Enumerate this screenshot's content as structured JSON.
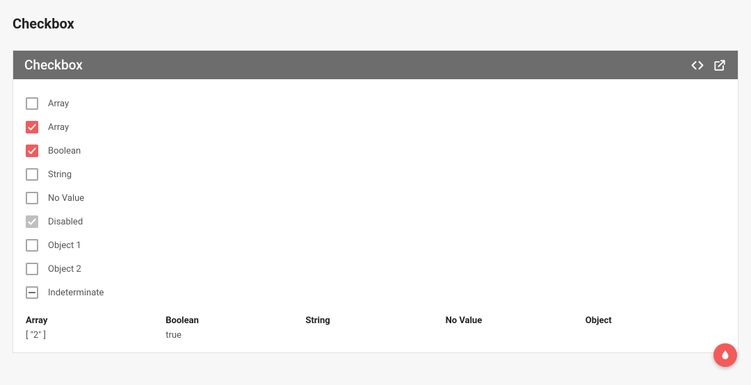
{
  "page": {
    "title": "Checkbox"
  },
  "card": {
    "title": "Checkbox"
  },
  "colors": {
    "accent": "#f45a5a",
    "header_bg": "#6d6d6d",
    "disabled_fill": "#bfbfbf"
  },
  "checkboxes": [
    {
      "label": "Array",
      "state": "unchecked"
    },
    {
      "label": "Array",
      "state": "checked"
    },
    {
      "label": "Boolean",
      "state": "checked"
    },
    {
      "label": "String",
      "state": "unchecked"
    },
    {
      "label": "No Value",
      "state": "unchecked"
    },
    {
      "label": "Disabled",
      "state": "disabled"
    },
    {
      "label": "Object 1",
      "state": "unchecked"
    },
    {
      "label": "Object 2",
      "state": "unchecked"
    },
    {
      "label": "Indeterminate",
      "state": "indeterminate"
    }
  ],
  "results": {
    "columns": [
      "Array",
      "Boolean",
      "String",
      "No Value",
      "Object"
    ],
    "values": [
      "[ \"2\" ]",
      "true",
      "",
      "",
      ""
    ]
  }
}
